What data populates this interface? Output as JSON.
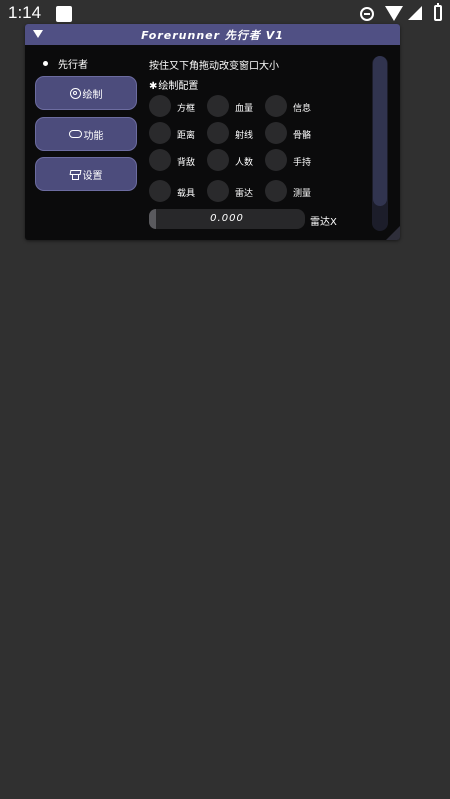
{
  "status_bar": {
    "time": "1:14",
    "icons": [
      "app-notification-icon",
      "do-not-disturb-icon",
      "wifi-icon",
      "signal-icon",
      "battery-icon"
    ]
  },
  "window": {
    "title": "Forerunner 先行者 V1",
    "brand": "先行者",
    "nav": [
      {
        "label": "绘制",
        "icon": "user-icon"
      },
      {
        "label": "功能",
        "icon": "gamepad-icon"
      },
      {
        "label": "设置",
        "icon": "settings-icon"
      }
    ],
    "hint": "按住又下角拖动改变窗口大小",
    "section": {
      "asterisk": "✱",
      "title": "绘制配置"
    },
    "options": [
      {
        "label": "方框"
      },
      {
        "label": "血量"
      },
      {
        "label": "信息"
      },
      {
        "label": "距离"
      },
      {
        "label": "射线"
      },
      {
        "label": "骨骼"
      },
      {
        "label": "背敌"
      },
      {
        "label": "人数"
      },
      {
        "label": "手持"
      },
      {
        "label": "载具"
      },
      {
        "label": "雷达"
      },
      {
        "label": "测量"
      }
    ],
    "slider": {
      "value_text": "0.000",
      "label": "雷达X",
      "fill_fraction": 0.0
    }
  },
  "colors": {
    "background": "#303030",
    "window": "#0b0b0c",
    "titlebar": "#505084",
    "nav_button": "#4c4c7c",
    "checkbox": "#2a2a2c"
  }
}
